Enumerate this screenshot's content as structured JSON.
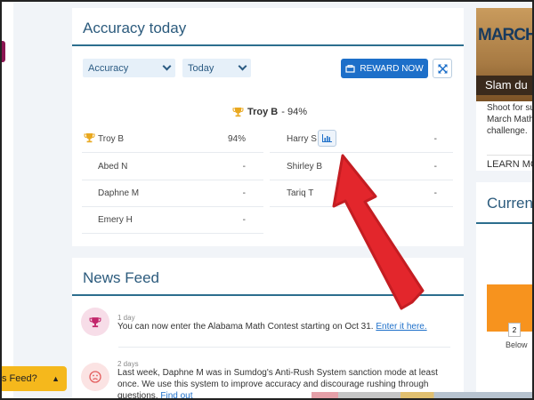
{
  "accuracy_card": {
    "title": "Accuracy today",
    "metric_dropdown": "Accuracy",
    "period_dropdown": "Today",
    "reward_button": "REWARD NOW",
    "top_student": {
      "name": "Troy B",
      "score": "- 94%"
    },
    "left_rows": [
      {
        "name": "Troy B",
        "score": "94%"
      },
      {
        "name": "Abed N",
        "score": "-"
      },
      {
        "name": "Daphne M",
        "score": "-"
      },
      {
        "name": "Emery H",
        "score": "-"
      }
    ],
    "right_rows": [
      {
        "name": "Harry S",
        "score": "-"
      },
      {
        "name": "Shirley B",
        "score": "-"
      },
      {
        "name": "Tariq T",
        "score": "-"
      }
    ]
  },
  "news_feed": {
    "title": "News Feed",
    "items": [
      {
        "days": "1 day",
        "text": "You can now enter the Alabama Math Contest starting on Oct 31.",
        "link": "Enter it here."
      },
      {
        "days": "2 days",
        "text": "Last week, Daphne M was in Sumdog's Anti-Rush System sanction mode at least once. We use this system to improve accuracy and discourage rushing through questions.",
        "link": "Find out"
      }
    ]
  },
  "side_promo": {
    "image_title": "MARCH",
    "image_band": "Slam du",
    "text_lines": [
      "Shoot for su",
      "March Math",
      "challenge."
    ],
    "learn_more": "LEARN MO"
  },
  "side_current": {
    "title": "Current",
    "badge_value": "2",
    "label": "Below"
  },
  "help_button": {
    "label": "s Feed?"
  },
  "colors": {
    "accent_blue": "#1d6fc9",
    "header_blue": "#2c5b7d",
    "trophy_gold": "#e9a81f",
    "annotation_red": "#e3262c",
    "orange": "#f7931e"
  },
  "icons": [
    "chevron-down-icon",
    "gift-icon",
    "expand-icon",
    "trophy-icon",
    "bar-chart-icon",
    "news-trophy-icon",
    "sad-face-icon",
    "chevron-up-icon"
  ]
}
